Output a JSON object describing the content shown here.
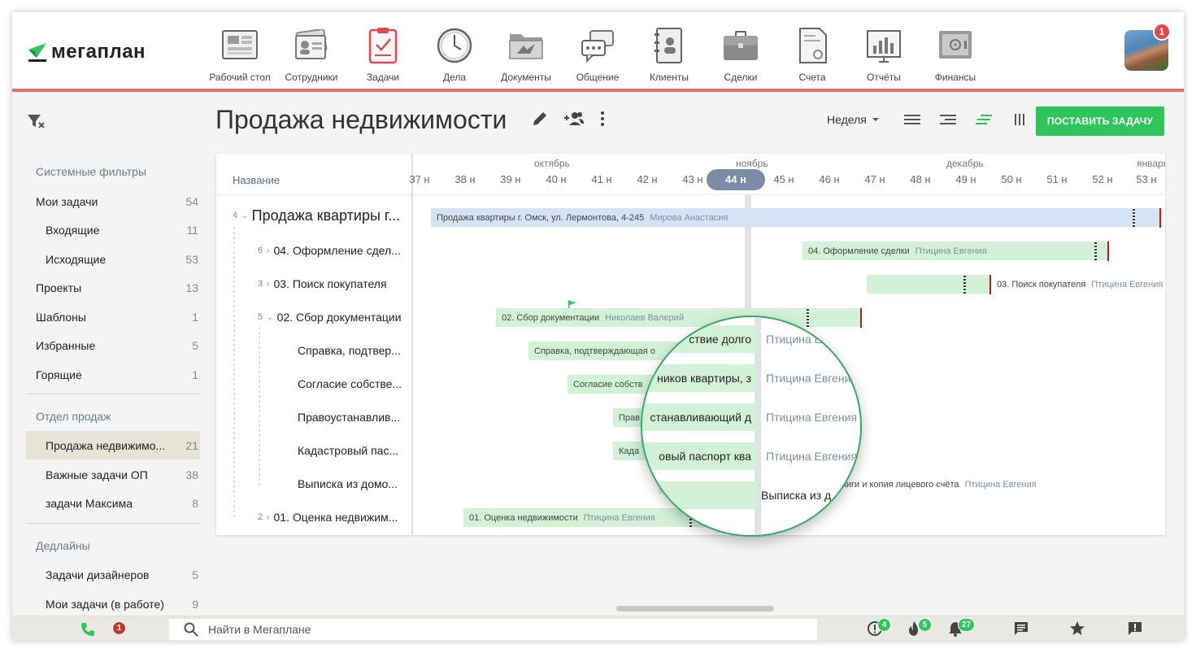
{
  "app": {
    "logo_text": "мегаплан"
  },
  "nav": [
    {
      "label": "Рабочий стол",
      "icon": "desktop-icon"
    },
    {
      "label": "Сотрудники",
      "icon": "employees-icon"
    },
    {
      "label": "Задачи",
      "icon": "tasks-icon",
      "active": true
    },
    {
      "label": "Дела",
      "icon": "clock-icon"
    },
    {
      "label": "Документы",
      "icon": "folder-icon"
    },
    {
      "label": "Общение",
      "icon": "chat-icon"
    },
    {
      "label": "Клиенты",
      "icon": "contacts-icon"
    },
    {
      "label": "Сделки",
      "icon": "briefcase-icon"
    },
    {
      "label": "Счета",
      "icon": "invoice-icon"
    },
    {
      "label": "Отчёты",
      "icon": "report-icon"
    },
    {
      "label": "Финансы",
      "icon": "safe-icon"
    }
  ],
  "user": {
    "notifications": "1"
  },
  "sidebar": {
    "section_system": "Системные фильтры",
    "items": [
      {
        "label": "Мои задачи",
        "count": "54"
      },
      {
        "label": "Входящие",
        "count": "11"
      },
      {
        "label": "Исходящие",
        "count": "53"
      },
      {
        "label": "Проекты",
        "count": "13"
      },
      {
        "label": "Шаблоны",
        "count": "1"
      },
      {
        "label": "Избранные",
        "count": "5"
      },
      {
        "label": "Горящие",
        "count": "1"
      }
    ],
    "section_sales": "Отдел продаж",
    "sales_items": [
      {
        "label": "Продажа недвижимо...",
        "count": "21"
      },
      {
        "label": "Важные задачи ОП",
        "count": "38"
      },
      {
        "label": "задачи Максима",
        "count": "8"
      }
    ],
    "section_deadlines": "Дедлайны",
    "deadline_items": [
      {
        "label": "Задачи дизайнеров",
        "count": "5"
      },
      {
        "label": "Мои задачи (в работе)",
        "count": "9"
      }
    ]
  },
  "page": {
    "title": "Продажа недвижимости",
    "view_select": "Неделя",
    "add_button": "ПОСТАВИТЬ ЗАДАЧУ"
  },
  "gantt": {
    "column_header": "Название",
    "months": [
      "октябрь",
      "ноябрь",
      "декабрь",
      "январь"
    ],
    "weeks": [
      "37 н",
      "38 н",
      "39 н",
      "40 н",
      "41 н",
      "42 н",
      "43 н",
      "44 н",
      "45 н",
      "46 н",
      "47 н",
      "48 н",
      "49 н",
      "50 н",
      "51 н",
      "52 н",
      "53 н"
    ],
    "current_week": "44 н",
    "tasks": [
      {
        "num": "4",
        "name": "Продажа квартиры г...",
        "bar_text": "Продажа квартиры г. Омск, ул. Лермонтова, 4-245",
        "who": "Мирова Анастасия"
      },
      {
        "num": "6",
        "name": "04. Оформление сдел...",
        "bar_text": "04. Оформление сделки",
        "who": "Птицина Евгения"
      },
      {
        "num": "3",
        "name": "03. Поиск покупателя",
        "bar_text": "03. Поиск покупателя",
        "who": "Птицина Евгения"
      },
      {
        "num": "5",
        "name": "02. Сбор документации",
        "bar_text": "02. Сбор документации",
        "who": "Николаев Валерий"
      },
      {
        "num": "",
        "name": "Справка, подтвер...",
        "bar_text": "Справка, подтверждающая о",
        "who": ""
      },
      {
        "num": "",
        "name": "Согласие собстве...",
        "bar_text": "Согласие собств",
        "who": ""
      },
      {
        "num": "",
        "name": "Правоустанавлив...",
        "bar_text": "Прав",
        "who": ""
      },
      {
        "num": "",
        "name": "Кадастровый пас...",
        "bar_text": "Када",
        "who": ""
      },
      {
        "num": "",
        "name": "Выписка из домо...",
        "bar_text": "",
        "who": ""
      },
      {
        "num": "2",
        "name": "01. Оценка недвижим...",
        "bar_text": "01. Оценка недвижимости",
        "who": "Птицина Евгения"
      }
    ],
    "outside_label": {
      "text": "книги и копия лицевого счёта",
      "who": "Птицина Евгения"
    }
  },
  "magnifier": {
    "rows": [
      {
        "text": "ствие долго",
        "who": "Птицина Е"
      },
      {
        "text": "ников квартиры, з",
        "who": "Птицина Евгения"
      },
      {
        "text": "станавливающий д",
        "who": "Птицина Евгения"
      },
      {
        "text": "овый паспорт ква",
        "who": "Птицина Евгения"
      },
      {
        "text": "Выписка из д",
        "who": ""
      }
    ]
  },
  "bottombar": {
    "calls_badge": "1",
    "search_placeholder": "Найти в Мегаплане",
    "alerts_badge": "4",
    "hot_badge": "5",
    "bell_badge": "27"
  },
  "colors": {
    "accent": "#2ec65a",
    "brand_red": "#f26b6b",
    "current_week": "#7d8aa8",
    "bar_blue": "#d6e3f4",
    "bar_green": "#d2f2d8",
    "deadline": "#b01e1e"
  }
}
